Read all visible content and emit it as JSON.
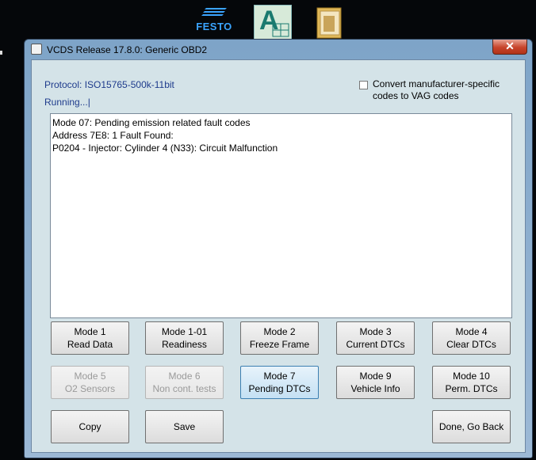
{
  "desktop": {
    "festo_label": "FESTO"
  },
  "window": {
    "title": "VCDS Release 17.8.0:  Generic OBD2",
    "close_label": "✕"
  },
  "status": {
    "protocol": "Protocol: ISO15765-500k-11bit",
    "running": "Running...|"
  },
  "option": {
    "label": "Convert manufacturer-specific codes to VAG codes",
    "checked": false
  },
  "output": {
    "lines": [
      "Mode 07: Pending emission related fault codes",
      "",
      "Address 7E8: 1 Fault Found:",
      "P0204 - Injector: Cylinder 4 (N33): Circuit Malfunction"
    ]
  },
  "buttons": {
    "mode1": {
      "line1": "Mode 1",
      "line2": "Read Data"
    },
    "mode1_01": {
      "line1": "Mode 1-01",
      "line2": "Readiness"
    },
    "mode2": {
      "line1": "Mode 2",
      "line2": "Freeze Frame"
    },
    "mode3": {
      "line1": "Mode 3",
      "line2": "Current DTCs"
    },
    "mode4": {
      "line1": "Mode 4",
      "line2": "Clear DTCs"
    },
    "mode5": {
      "line1": "Mode 5",
      "line2": "O2 Sensors"
    },
    "mode6": {
      "line1": "Mode 6",
      "line2": "Non cont. tests"
    },
    "mode7": {
      "line1": "Mode 7",
      "line2": "Pending DTCs"
    },
    "mode9": {
      "line1": "Mode 9",
      "line2": "Vehicle Info"
    },
    "mode10": {
      "line1": "Mode 10",
      "line2": "Perm. DTCs"
    },
    "copy": "Copy",
    "save": "Save",
    "done": "Done, Go Back"
  },
  "colors": {
    "status_text": "#1e3b8c",
    "client_bg": "#d4e3e8",
    "close_red": "#c7442b"
  }
}
